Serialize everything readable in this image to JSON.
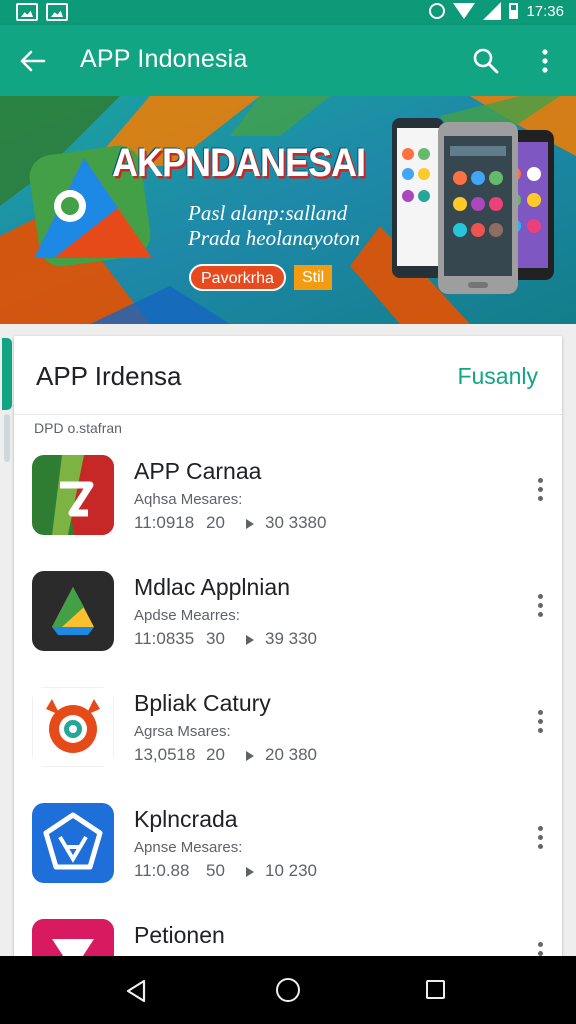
{
  "status_bar": {
    "time": "17:36"
  },
  "app_bar": {
    "title": "APP Indonesia"
  },
  "banner": {
    "brand": "AKPNDANESAI",
    "line1": "Pasl alanp:salland",
    "line2": "Prada heolanayoton",
    "primary_button": "Pavorkrha",
    "secondary_button": "Stil"
  },
  "list": {
    "header_title": "APP Irdensa",
    "header_action": "Fusanly",
    "subheader": "DPD o.stafran",
    "items": [
      {
        "name": "APP Carnaa",
        "subtitle": "Aqhsa Mesares:",
        "stat1": "11:0918",
        "stat2": "20",
        "stat3": "30 3380"
      },
      {
        "name": "Mdlac Applnian",
        "subtitle": "Apdse Mearres:",
        "stat1": "11:0835",
        "stat2": "30",
        "stat3": "39 330"
      },
      {
        "name": "Bpliak Catury",
        "subtitle": "Agrsa Msares:",
        "stat1": "13,0518",
        "stat2": "20",
        "stat3": "20 380"
      },
      {
        "name": "Kplncrada",
        "subtitle": "Apnse Mesares:",
        "stat1": "11:0.88",
        "stat2": "50",
        "stat3": "10 230"
      },
      {
        "name": "Petionen",
        "subtitle": "",
        "stat1": "",
        "stat2": "",
        "stat3": ""
      }
    ]
  },
  "colors": {
    "primary": "#12a583",
    "status_bar": "#0d9a78",
    "accent_orange": "#e74a1e"
  },
  "icons": [
    "back-arrow-icon",
    "search-icon",
    "more-vert-icon",
    "alarm-icon",
    "wifi-icon",
    "cell-signal-icon",
    "battery-icon",
    "nav-back-icon",
    "nav-home-icon",
    "nav-recents-icon"
  ]
}
